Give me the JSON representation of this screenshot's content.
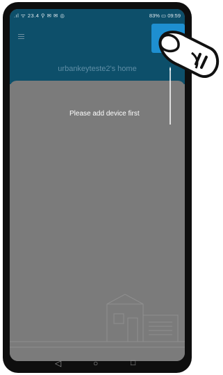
{
  "status_bar": {
    "left": ".ıl ᯤ 23.4 ⚲ ✉ ✉ ◎",
    "battery": "83%",
    "time": "09:59"
  },
  "header": {
    "menu_icon": "menu-icon",
    "add_button_icon": "add-device-button"
  },
  "home": {
    "title": "urbankeyteste2's home"
  },
  "main": {
    "hint": "Please add device first"
  },
  "nav": {
    "back": "◁",
    "home": "○",
    "recent": "□"
  },
  "colors": {
    "header_bg": "#0d4f6a",
    "accent": "#1e8fd0",
    "content_bg": "#7b7b7b"
  }
}
